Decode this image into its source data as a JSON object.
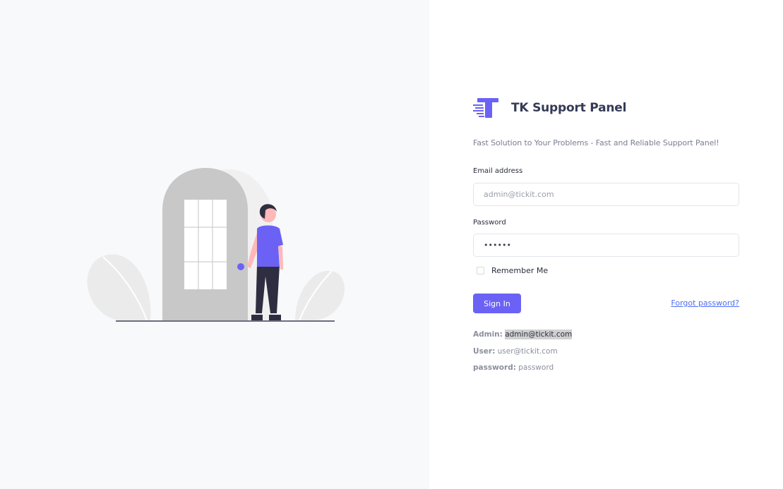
{
  "brand": {
    "name": "TK Support Panel",
    "tagline": "Fast Solution to Your Problems - Fast and Reliable Support Panel!",
    "accent_color": "#6b62f5"
  },
  "form": {
    "email_label": "Email address",
    "email_placeholder": "admin@tickit.com",
    "password_label": "Password",
    "password_value": "••••••",
    "remember_label": "Remember Me",
    "signin_label": "Sign In",
    "forgot_label": "Forgot password?"
  },
  "credentials": {
    "admin_label": "Admin:",
    "admin_value": "admin@tickit.com",
    "user_label": "User:",
    "user_value": "user@tickit.com",
    "password_label": "password:",
    "password_value": "password"
  },
  "illustration": {
    "icon": "person-at-door-illustration"
  }
}
